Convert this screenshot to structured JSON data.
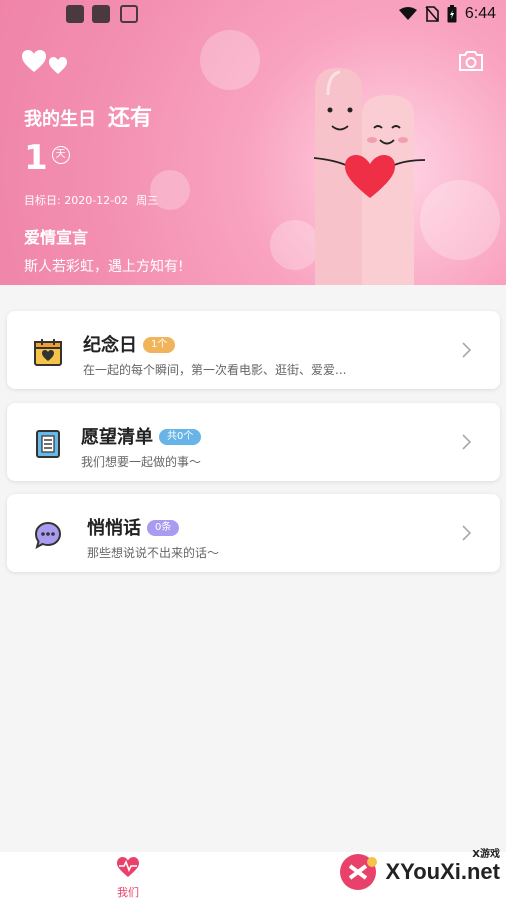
{
  "status_bar": {
    "time": "6:44"
  },
  "header": {
    "birthday_label": "我的生日",
    "remaining_label": "还有",
    "days_count": "1",
    "days_unit": "天",
    "target_date": "目标日: 2020-12-02",
    "target_weekday": "周三",
    "declaration_title": "爱情宣言",
    "declaration_text": "斯人若彩虹，遇上方知有!"
  },
  "cards": [
    {
      "title": "纪念日",
      "badge": "1个",
      "desc": "在一起的每个瞬间，第一次看电影、逛街、爱爱...",
      "icon": "calendar-heart-icon",
      "badge_color": "#f2b45a"
    },
    {
      "title": "愿望清单",
      "badge": "共0个",
      "desc": "我们想要一起做的事～",
      "icon": "notebook-icon",
      "badge_color": "#68b4e8"
    },
    {
      "title": "悄悄话",
      "badge": "0条",
      "desc": "那些想说说不出来的话～",
      "icon": "chat-bubble-icon",
      "badge_color": "#a99cf0"
    }
  ],
  "bottom_nav": {
    "home_label": "我们"
  },
  "watermark": {
    "text": "XYouXi.net",
    "small": "X游戏"
  },
  "colors": {
    "accent": "#e8416a",
    "header_pink": "#f38fb1"
  }
}
